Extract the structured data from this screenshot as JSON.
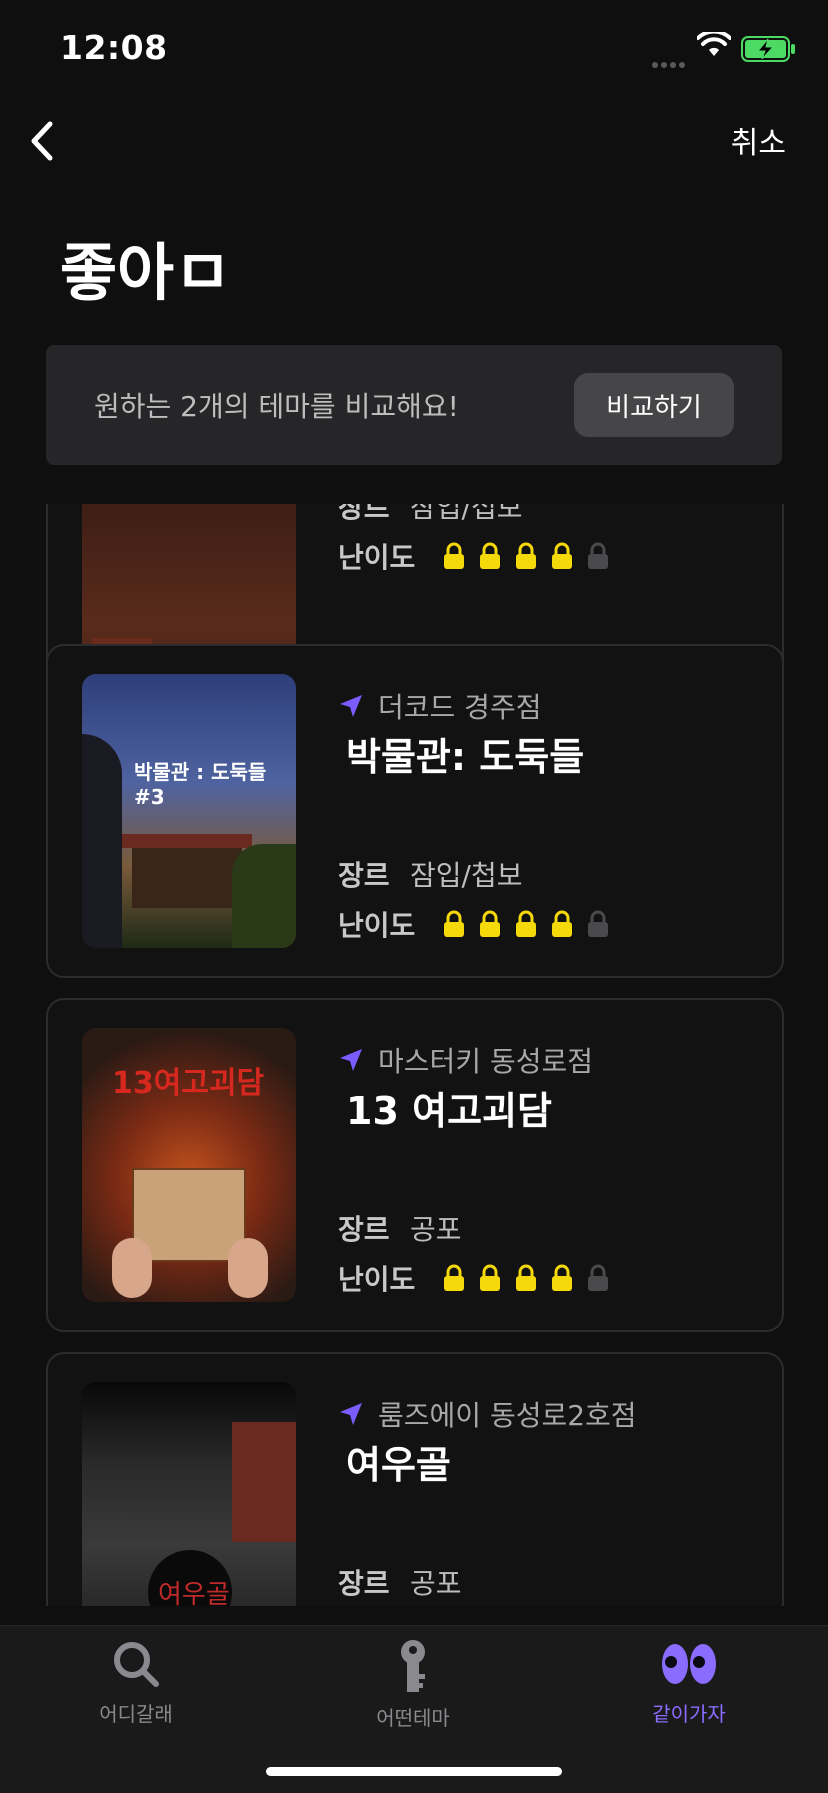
{
  "status_bar": {
    "time": "12:08"
  },
  "nav": {
    "cancel_label": "취소"
  },
  "page": {
    "title": "좋아ㅁ"
  },
  "compare": {
    "text": "원하는 2개의 테마를 비교해요!",
    "button_label": "비교하기"
  },
  "labels": {
    "genre": "장르",
    "difficulty": "난이도"
  },
  "cards": [
    {
      "location": "",
      "name": "",
      "genre": "잠입/접보",
      "difficulty": 4,
      "max_difficulty": 5
    },
    {
      "location": "더코드 경주점",
      "name": "박물관: 도둑들",
      "genre": "잠입/첩보",
      "difficulty": 4,
      "max_difficulty": 5,
      "poster_text": "박물관 : 도둑들 #3"
    },
    {
      "location": "마스터키 동성로점",
      "name": "13 여고괴담",
      "genre": "공포",
      "difficulty": 4,
      "max_difficulty": 5,
      "poster_text": "13여고괴담"
    },
    {
      "location": "룸즈에이 동성로2호점",
      "name": "여우골",
      "genre": "공포",
      "difficulty": null,
      "max_difficulty": 5,
      "poster_text": "여우골"
    }
  ],
  "tabs": [
    {
      "label": "어디갈래",
      "icon": "search-icon",
      "active": false
    },
    {
      "label": "어떤테마",
      "icon": "key-icon",
      "active": false
    },
    {
      "label": "같이가자",
      "icon": "eyes-icon",
      "active": true
    }
  ],
  "colors": {
    "accent": "#8a6cff",
    "lock_filled": "#f5d90a",
    "lock_empty": "#4a4a4c",
    "location_arrow": "#7b5cff"
  }
}
